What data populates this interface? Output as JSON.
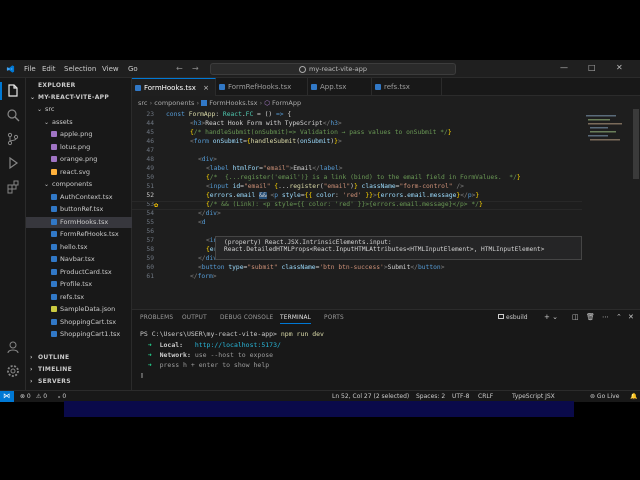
{
  "window": {
    "menus": [
      "File",
      "Edit",
      "Selection",
      "View",
      "Go"
    ],
    "search_text": "my-react-vite-app",
    "controls": [
      "—",
      "□",
      "✕"
    ]
  },
  "sidebar": {
    "explorer_label": "EXPLORER",
    "project": "MY-REACT-VITE-APP",
    "items": [
      {
        "label": "src",
        "kind": "folder",
        "depth": 1
      },
      {
        "label": "assets",
        "kind": "folder",
        "depth": 2
      },
      {
        "label": "apple.png",
        "kind": "png",
        "depth": 3
      },
      {
        "label": "lotus.png",
        "kind": "png",
        "depth": 3
      },
      {
        "label": "orange.png",
        "kind": "png",
        "depth": 3
      },
      {
        "label": "react.svg",
        "kind": "svg",
        "depth": 3
      },
      {
        "label": "components",
        "kind": "folder",
        "depth": 2
      },
      {
        "label": "AuthContext.tsx",
        "kind": "tsx",
        "depth": 3
      },
      {
        "label": "buttonRef.tsx",
        "kind": "tsx",
        "depth": 3
      },
      {
        "label": "FormHooks.tsx",
        "kind": "tsx",
        "depth": 3,
        "selected": true
      },
      {
        "label": "FormRefHooks.tsx",
        "kind": "tsx",
        "depth": 3
      },
      {
        "label": "hello.tsx",
        "kind": "tsx",
        "depth": 3
      },
      {
        "label": "Navbar.tsx",
        "kind": "tsx",
        "depth": 3
      },
      {
        "label": "ProductCard.tsx",
        "kind": "tsx",
        "depth": 3
      },
      {
        "label": "Profile.tsx",
        "kind": "tsx",
        "depth": 3
      },
      {
        "label": "refs.tsx",
        "kind": "tsx",
        "depth": 3
      },
      {
        "label": "SampleData.json",
        "kind": "json",
        "depth": 3
      },
      {
        "label": "ShoppingCart.tsx",
        "kind": "tsx",
        "depth": 3
      },
      {
        "label": "ShoppingCart1.tsx",
        "kind": "tsx",
        "depth": 3
      }
    ],
    "outline": "OUTLINE",
    "timeline": "TIMELINE",
    "servers": "SERVERS"
  },
  "tabs": [
    "FormHooks.tsx",
    "FormRefHooks.tsx",
    "App.tsx",
    "refs.tsx"
  ],
  "breadcrumb": [
    "src",
    "components",
    "FormHooks.tsx",
    "FormApp"
  ],
  "code": {
    "line_numbers": [
      "23",
      "44",
      "45",
      "46",
      "47",
      "48",
      "49",
      "50",
      "51",
      "52",
      "53",
      "54",
      "55",
      "56",
      "57",
      "58",
      "59",
      "60",
      "61"
    ],
    "current_line": "52"
  },
  "hover": {
    "line1": "(property) React.JSX.IntrinsicElements.input:",
    "line2": "React.DetailedHTMLProps<React.InputHTMLAttributes<HTMLInputElement>, HTMLInputElement>"
  },
  "panel": {
    "tabs": [
      "PROBLEMS",
      "OUTPUT",
      "DEBUG CONSOLE",
      "TERMINAL",
      "PORTS"
    ],
    "shell": "esbuild",
    "terminal": {
      "prompt": "PS C:\\Users\\USER\\my-react-vite-app> ",
      "command": "npm run dev",
      "local_label": "Local:",
      "local_url": "http://localhost:5173/",
      "network_label": "Network:",
      "network_text": "use --host to expose",
      "help_text": "press h + enter to show help"
    }
  },
  "status": {
    "errors": "⊗ 0",
    "warnings": "⚠ 0",
    "ports": "ₒ 0",
    "position": "Ln 52, Col 27 (2 selected)",
    "spaces": "Spaces: 2",
    "encoding": "UTF-8",
    "eol": "CRLF",
    "language": "TypeScript JSX",
    "golive": "⊚ Go Live"
  },
  "colors": {
    "accent": "#0078d4",
    "background": "#1e1e1e",
    "sidebar": "#181818",
    "tsx_icon": "#3178c6"
  }
}
